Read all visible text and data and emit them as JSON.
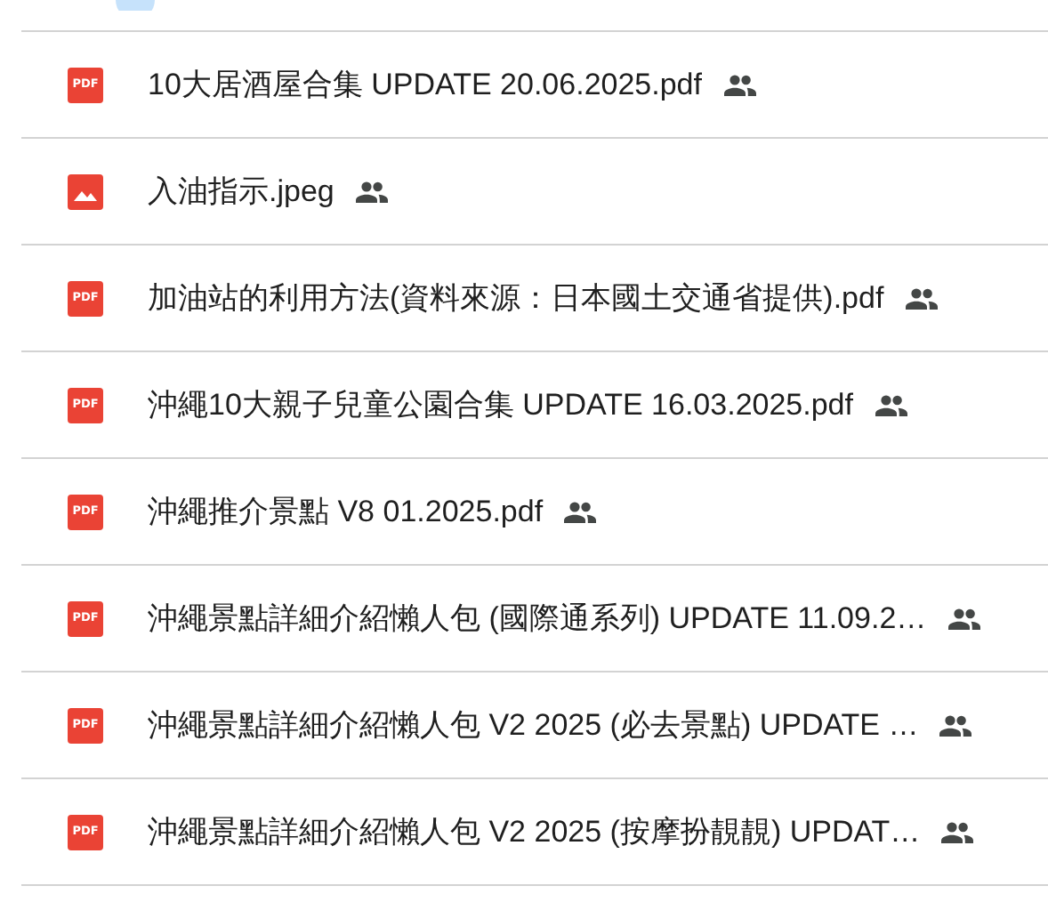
{
  "files": [
    {
      "name": "10大居酒屋合集 UPDATE 20.06.2025.pdf",
      "kind": "pdf",
      "badge": "PDF",
      "shared": true
    },
    {
      "name": "入油指示.jpeg",
      "kind": "image",
      "shared": true
    },
    {
      "name": "加油站的利用方法(資料來源：日本國土交通省提供).pdf",
      "kind": "pdf",
      "badge": "PDF",
      "shared": true
    },
    {
      "name": "沖繩10大親子兒童公園合集 UPDATE 16.03.2025.pdf",
      "kind": "pdf",
      "badge": "PDF",
      "shared": true
    },
    {
      "name": "沖繩推介景點 V8 01.2025.pdf",
      "kind": "pdf",
      "badge": "PDF",
      "shared": true
    },
    {
      "name": "沖繩景點詳細介紹懶人包 (國際通系列) UPDATE 11.09.2…",
      "kind": "pdf",
      "badge": "PDF",
      "shared": true
    },
    {
      "name": "沖繩景點詳細介紹懶人包 V2 2025 (必去景點) UPDATE …",
      "kind": "pdf",
      "badge": "PDF",
      "shared": true
    },
    {
      "name": "沖繩景點詳細介紹懶人包 V2 2025 (按摩扮靚靚) UPDAT…",
      "kind": "pdf",
      "badge": "PDF",
      "shared": true
    }
  ]
}
